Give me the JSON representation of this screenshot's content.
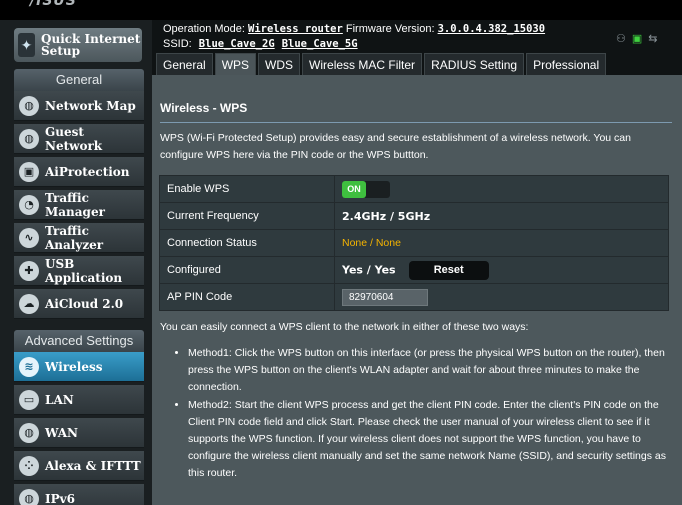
{
  "sidebar": {
    "quick_internet_setup": "Quick Internet Setup",
    "general_header": "General",
    "general_items": [
      {
        "label": "Network Map",
        "icon": "globe-icon"
      },
      {
        "label": "Guest Network",
        "icon": "guest-globe-icon"
      },
      {
        "label": "AiProtection",
        "icon": "lock-icon"
      },
      {
        "label": "Traffic Manager",
        "icon": "gauge-icon"
      },
      {
        "label": "Traffic Analyzer",
        "icon": "analyzer-icon"
      },
      {
        "label": "USB Application",
        "icon": "puzzle-icon"
      },
      {
        "label": "AiCloud 2.0",
        "icon": "cloud-icon"
      }
    ],
    "advanced_header": "Advanced Settings",
    "advanced_items": [
      {
        "label": "Wireless",
        "icon": "wifi-icon",
        "active": true
      },
      {
        "label": "LAN",
        "icon": "monitor-icon"
      },
      {
        "label": "WAN",
        "icon": "globe-icon"
      },
      {
        "label": "Alexa & IFTTT",
        "icon": "dots-icon"
      },
      {
        "label": "IPv6",
        "icon": "ipv6-icon"
      }
    ]
  },
  "header": {
    "operation_mode_label": "Operation Mode:",
    "operation_mode_value": "Wireless router",
    "firmware_label": "Firmware Version:",
    "firmware_value": "3.0.0.4.382_15030",
    "ssid_label": "SSID:",
    "ssid_2g": "Blue_Cave_2G",
    "ssid_5g": "Blue_Cave_5G",
    "status_icons": [
      "users-icon",
      "usb-icon",
      "network-icon"
    ]
  },
  "tabs": [
    {
      "label": "General"
    },
    {
      "label": "WPS",
      "active": true
    },
    {
      "label": "WDS"
    },
    {
      "label": "Wireless MAC Filter"
    },
    {
      "label": "RADIUS Setting"
    },
    {
      "label": "Professional"
    }
  ],
  "panel": {
    "title": "Wireless - WPS",
    "description": "WPS (Wi-Fi Protected Setup) provides easy and secure establishment of a wireless network. You can configure WPS here via the PIN code or the WPS buttton.",
    "rows": {
      "enable_wps_label": "Enable WPS",
      "enable_wps_value": "ON",
      "frequency_label": "Current Frequency",
      "frequency_value": "2.4GHz / 5GHz",
      "connection_label": "Connection Status",
      "connection_value": "None / None",
      "configured_label": "Configured",
      "configured_value": "Yes / Yes",
      "reset_label": "Reset",
      "ap_pin_label": "AP PIN Code",
      "ap_pin_value": "82970604"
    },
    "ways_intro": "You can easily connect a WPS client to the network in either of these two ways:",
    "method1": "Method1: Click the WPS button on this interface (or press the physical WPS button on the router), then press the WPS button on the client's WLAN adapter and wait for about three minutes to make the connection.",
    "method2": "Method2: Start the client WPS process and get the client PIN code. Enter the client's PIN code on the Client PIN code field and click Start. Please check the user manual of your wireless client to see if it supports the WPS function. If your wireless client does not support the WPS function, you have to configure the wireless client manually and set the same network Name (SSID), and security settings as this router."
  },
  "colors": {
    "accent_active": "#2a8bb8",
    "toggle_on": "#3fbf3f",
    "status_warning": "#f5b400",
    "panel_bg": "#4d585c"
  }
}
